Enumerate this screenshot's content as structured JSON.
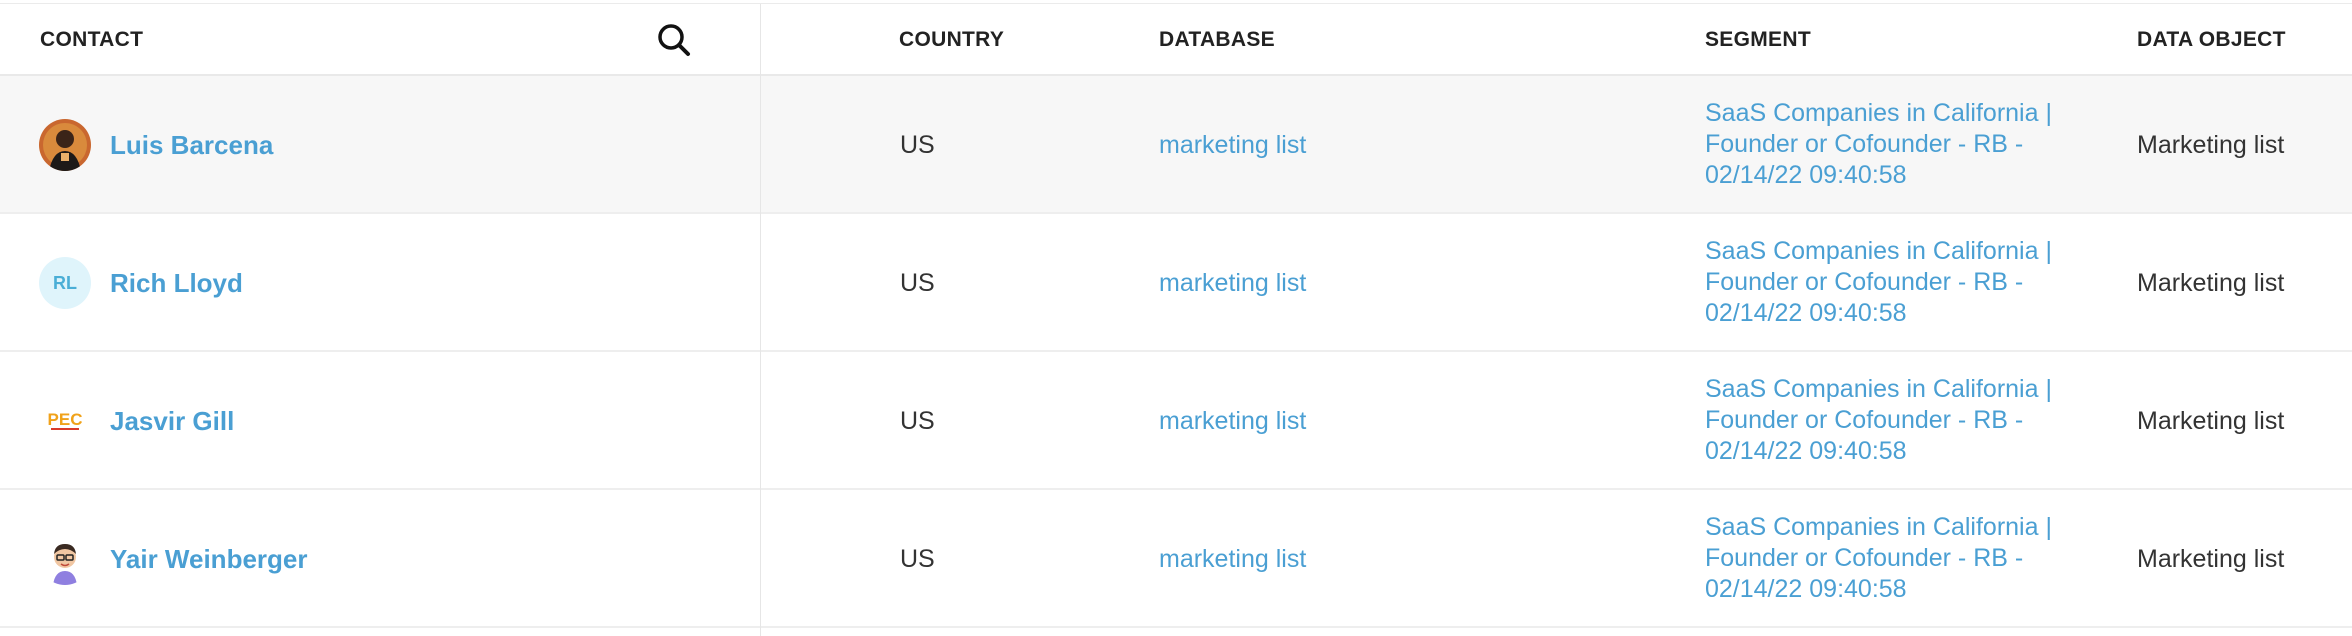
{
  "header": {
    "contact": "CONTACT",
    "country": "COUNTRY",
    "database": "DATABASE",
    "segment": "SEGMENT",
    "data_object": "DATA OBJECT",
    "search_icon": "search-icon"
  },
  "rows": [
    {
      "name": "Luis Barcena",
      "avatar": "photo",
      "country": "US",
      "database": "marketing list",
      "segment": "SaaS Companies in California | Founder or Cofounder - RB - 02/14/22 09:40:58",
      "data_object": "Marketing list"
    },
    {
      "name": "Rich Lloyd",
      "avatar_initials": "RL",
      "country": "US",
      "database": "marketing list",
      "segment": "SaaS Companies in California | Founder or Cofounder - RB - 02/14/22 09:40:58",
      "data_object": "Marketing list"
    },
    {
      "name": "Jasvir Gill",
      "avatar": "logo",
      "avatar_logo_text": "PEC",
      "country": "US",
      "database": "marketing list",
      "segment": "SaaS Companies in California | Founder or Cofounder - RB - 02/14/22 09:40:58",
      "data_object": "Marketing list"
    },
    {
      "name": "Yair Weinberger",
      "avatar": "cartoon",
      "country": "US",
      "database": "marketing list",
      "segment": "SaaS Companies in California | Founder or Cofounder - RB - 02/14/22 09:40:58",
      "data_object": "Marketing list"
    }
  ],
  "colors": {
    "link": "#4a9fd3",
    "text": "#333333",
    "header_text": "#222222",
    "highlight_row": "#f7f7f7",
    "initials_bg": "#dff4fb"
  }
}
